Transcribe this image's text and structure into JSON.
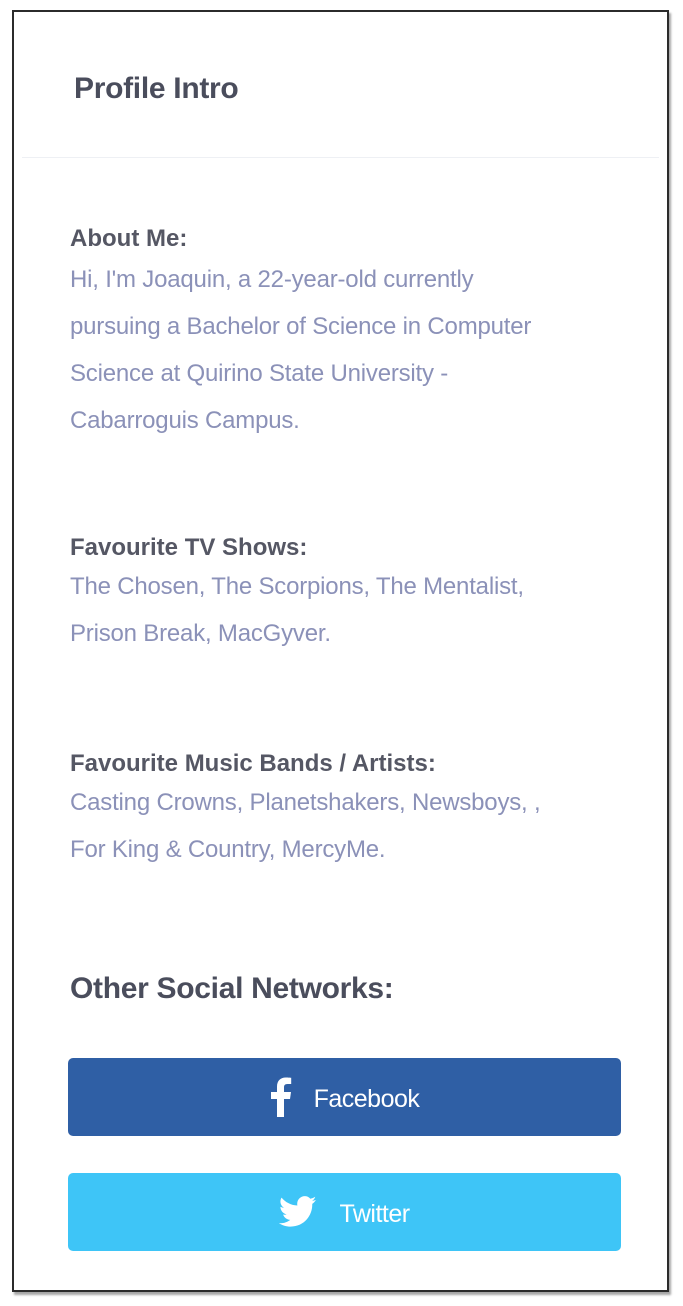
{
  "card": {
    "title": "Profile Intro"
  },
  "about": {
    "label": "About Me:",
    "lines": [
      "Hi, I'm Joaquin, a 22-year-old currently",
      "pursuing a Bachelor of Science in Computer",
      "Science at Quirino State University -",
      "Cabarroguis Campus."
    ]
  },
  "tv_shows": {
    "label": "Favourite TV Shows:",
    "lines": [
      "The Chosen, The Scorpions, The Mentalist,",
      "Prison Break, MacGyver."
    ]
  },
  "music": {
    "label": "Favourite Music Bands / Artists:",
    "lines": [
      "Casting Crowns, Planetshakers, Newsboys, ,",
      "For King & Country, MercyMe."
    ]
  },
  "social": {
    "title": "Other Social Networks:",
    "facebook": {
      "label": "Facebook",
      "icon": "facebook-icon",
      "color": "#2f5fa5"
    },
    "twitter": {
      "label": "Twitter",
      "icon": "twitter-icon",
      "color": "#3ec5f7"
    }
  },
  "colors": {
    "heading": "#4a4d5c",
    "label": "#555764",
    "body_text": "#8b91b8"
  }
}
